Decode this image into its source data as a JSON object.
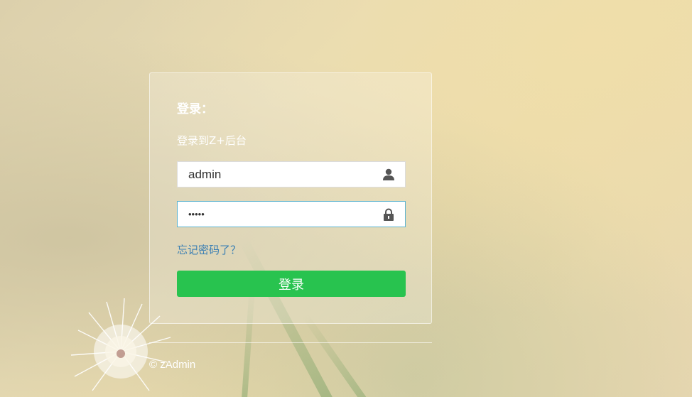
{
  "login": {
    "title": "登录：",
    "subtitle": "登录到Z+后台",
    "username": {
      "value": "admin",
      "icon": "user-icon"
    },
    "password": {
      "value": "•••••",
      "icon": "lock-icon"
    },
    "forgot_label": "忘记密码了？",
    "submit_label": "登录"
  },
  "footer": {
    "copyright": "© zAdmin"
  },
  "colors": {
    "primary_button": "#28c34f",
    "link": "#3a7fb3",
    "focus_border": "#5bb3cf"
  }
}
